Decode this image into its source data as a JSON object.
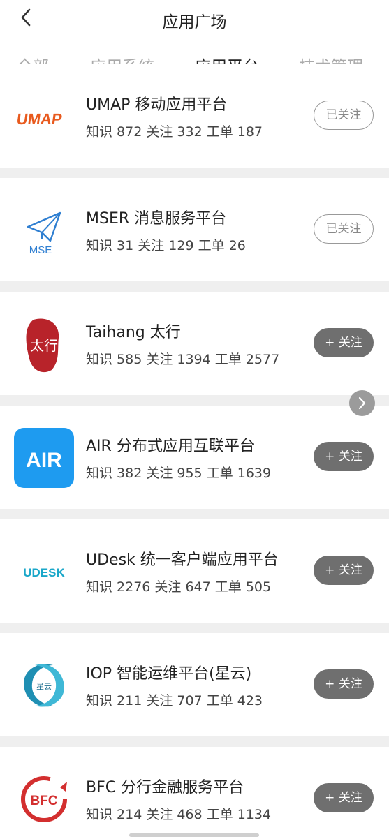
{
  "header": {
    "back_icon": "chevron-left-icon",
    "title": "应用广场"
  },
  "tabs": [
    {
      "label": "全部",
      "active": false
    },
    {
      "label": "应用系统",
      "active": false
    },
    {
      "label": "应用平台",
      "active": true
    },
    {
      "label": "技术管理",
      "active": false
    }
  ],
  "apps": [
    {
      "name": "UMAP 移动应用平台",
      "stats": "知识 872 关注 332 工单 187",
      "button": "已关注",
      "followed": true,
      "logo_text": "UMAP",
      "logo_color": "#e85a1e"
    },
    {
      "name": "MSER 消息服务平台",
      "stats": "知识 31 关注 129 工单 26",
      "button": "已关注",
      "followed": true,
      "logo_text": "MSE",
      "logo_color": "#2f7fd1"
    },
    {
      "name": "Taihang 太行",
      "stats": "知识 585 关注 1394 工单 2577",
      "button": "+ 关注",
      "followed": false,
      "logo_text": "太行",
      "logo_color": "#b8232a"
    },
    {
      "name": "AIR 分布式应用互联平台",
      "stats": "知识 382 关注 955 工单 1639",
      "button": "+ 关注",
      "followed": false,
      "logo_text": "AIR",
      "logo_color": "#1e9bf0"
    },
    {
      "name": "UDesk 统一客户端应用平台",
      "stats": "知识 2276 关注 647 工单 505",
      "button": "+ 关注",
      "followed": false,
      "logo_text": "UDESK",
      "logo_color": "#1aa7c9"
    },
    {
      "name": "IOP 智能运维平台(星云)",
      "stats": "知识 211 关注 707 工单 423",
      "button": "+ 关注",
      "followed": false,
      "logo_text": "星云",
      "logo_color": "#1f8fb3"
    },
    {
      "name": "BFC 分行金融服务平台",
      "stats": "知识 214 关注 468 工单 1134",
      "button": "+ 关注",
      "followed": false,
      "logo_text": "BFC",
      "logo_color": "#d32f2f"
    }
  ],
  "scroll_arrow_icon": "chevron-right-icon"
}
